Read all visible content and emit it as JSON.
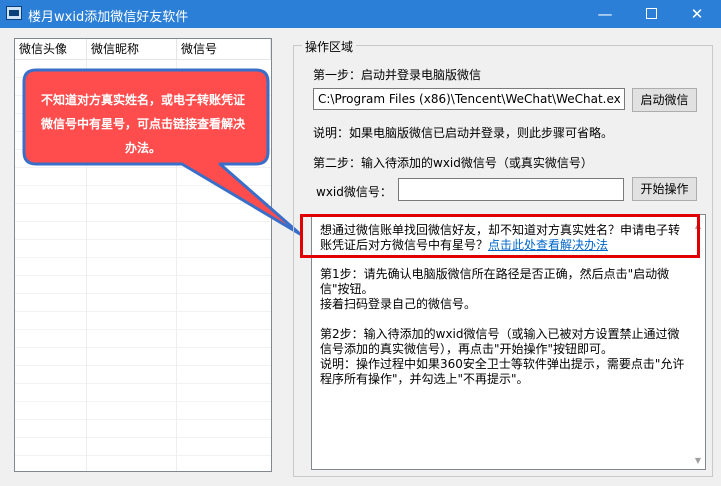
{
  "window": {
    "title": "楼月wxid添加微信好友软件",
    "minimize_glyph": "—",
    "close_glyph": "✕"
  },
  "list": {
    "columns": [
      "微信头像",
      "微信昵称",
      "微信号"
    ]
  },
  "callout": {
    "text": "不知道对方真实姓名，或电子转账凭证微信号中有星号，可点击链接查看解决办法。"
  },
  "operations": {
    "group_title": "操作区域",
    "step1_label": "第一步：启动并登录电脑版微信",
    "wechat_path": "C:\\Program Files (x86)\\Tencent\\WeChat\\WeChat.exe",
    "launch_button": "启动微信",
    "note": "说明：如果电脑版微信已启动并登录，则此步骤可省略。",
    "step2_label": "第二步：输入待添加的wxid微信号（或真实微信号）",
    "wxid_label": "wxid微信号：",
    "wxid_value": "",
    "start_button": "开始操作"
  },
  "info": {
    "highlight_text": "想通过微信账单找回微信好友，却不知道对方真实姓名？申请电子转账凭证后对方微信号中有星号？",
    "link_text": "点击此处查看解决办法",
    "step1_text": "第1步：请先确认电脑版微信所在路径是否正确，然后点击\"启动微信\"按钮。",
    "step1_text2": "接着扫码登录自己的微信号。",
    "step2_text": "第2步：输入待添加的wxid微信号（或输入已被对方设置禁止通过微信号添加的真实微信号），再点击\"开始操作\"按钮即可。",
    "step2_note": "说明：操作过程中如果360安全卫士等软件弹出提示，需要点击\"允许程序所有操作\"，并勾选上\"不再提示\"。"
  },
  "colors": {
    "titlebar": "#2b7fd6",
    "callout_fill": "#ff4c4c",
    "callout_border": "#3a6fc9",
    "highlight_border": "#e00000",
    "link": "#0066cc"
  }
}
